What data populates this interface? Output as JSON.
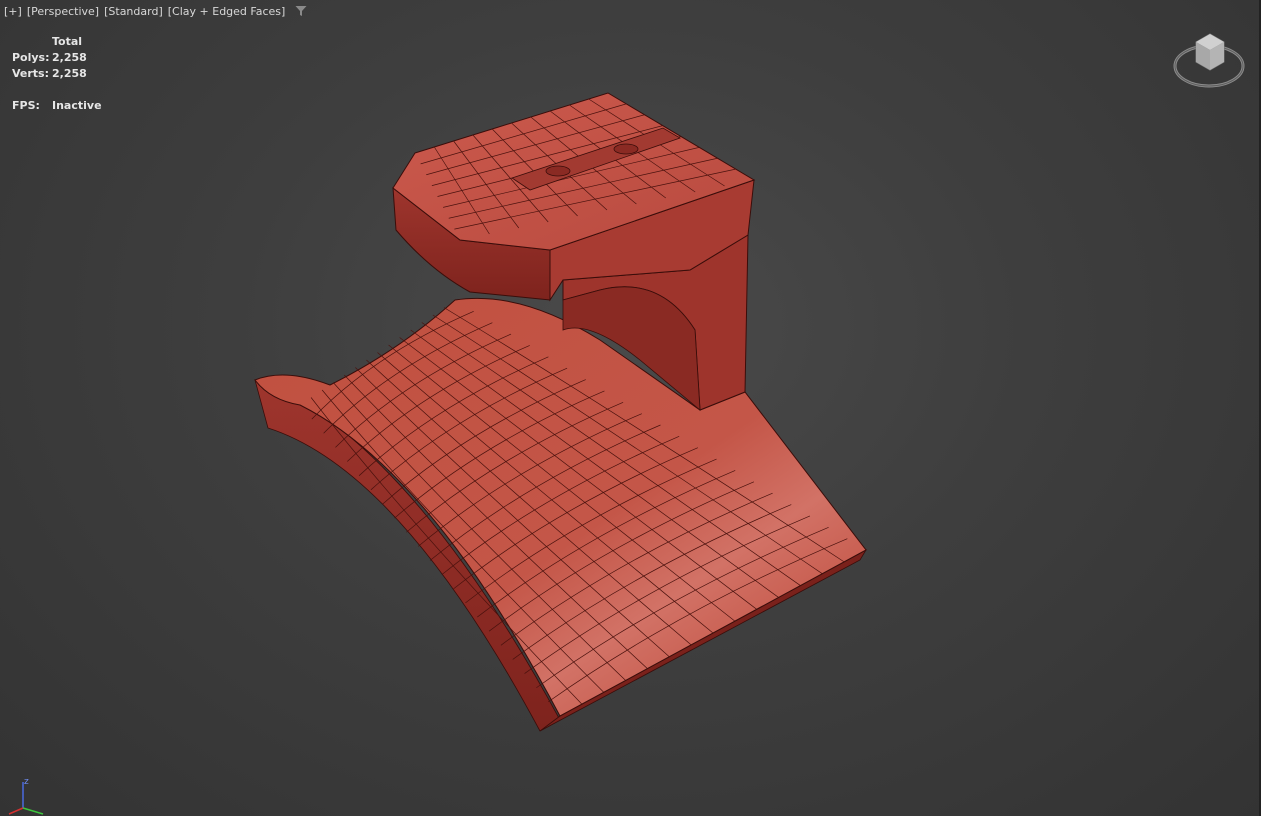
{
  "viewport": {
    "labels": [
      "[+]",
      "[Perspective]",
      "[Standard]",
      "[Clay + Edged Faces]"
    ]
  },
  "stats": {
    "header": "Total",
    "polys_label": "Polys:",
    "polys_value": "2,258",
    "verts_label": "Verts:",
    "verts_value": "2,258",
    "fps_label": "FPS:",
    "fps_value": "Inactive"
  },
  "colors": {
    "clay_top": "#c8564a",
    "clay_mid": "#b3463c",
    "clay_dark": "#8e2c25",
    "wire": "#3a0d0a",
    "axis_x": "#d43030",
    "axis_y": "#3cc43c",
    "axis_z": "#4a6ae0"
  },
  "icons": {
    "filter": "funnel-icon",
    "viewcube": "viewcube-icon",
    "axis": "axis-tripod-icon"
  },
  "axis": {
    "z_label": "z"
  }
}
